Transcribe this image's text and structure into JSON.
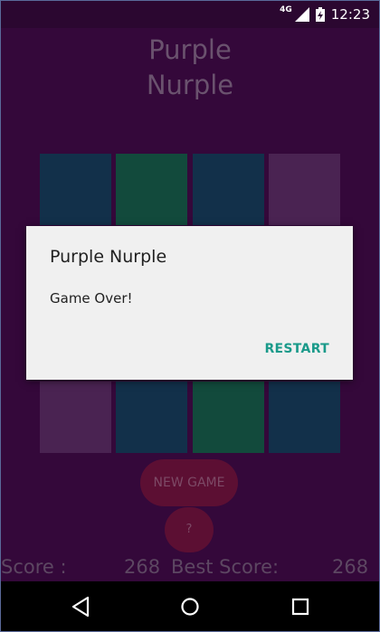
{
  "status": {
    "network": "4G",
    "time": "12:23"
  },
  "app": {
    "title_line1": "Purple",
    "title_line2": "Nurple",
    "tiles_top": [
      "#12304a",
      "#124a3c",
      "#12304a",
      "#4a2352"
    ],
    "tiles_bottom": [
      "#4a2352",
      "#12304a",
      "#124a3c",
      "#12304a"
    ],
    "new_game_label": "NEW GAME",
    "help_label": "?",
    "score_label": "Score :",
    "score_value": "268",
    "best_label": "Best Score:",
    "best_value": "268"
  },
  "dialog": {
    "title": "Purple Nurple",
    "message": "Game Over!",
    "button": "RESTART"
  },
  "nav": {
    "back": "back-icon",
    "home": "home-icon",
    "recents": "recents-icon"
  }
}
